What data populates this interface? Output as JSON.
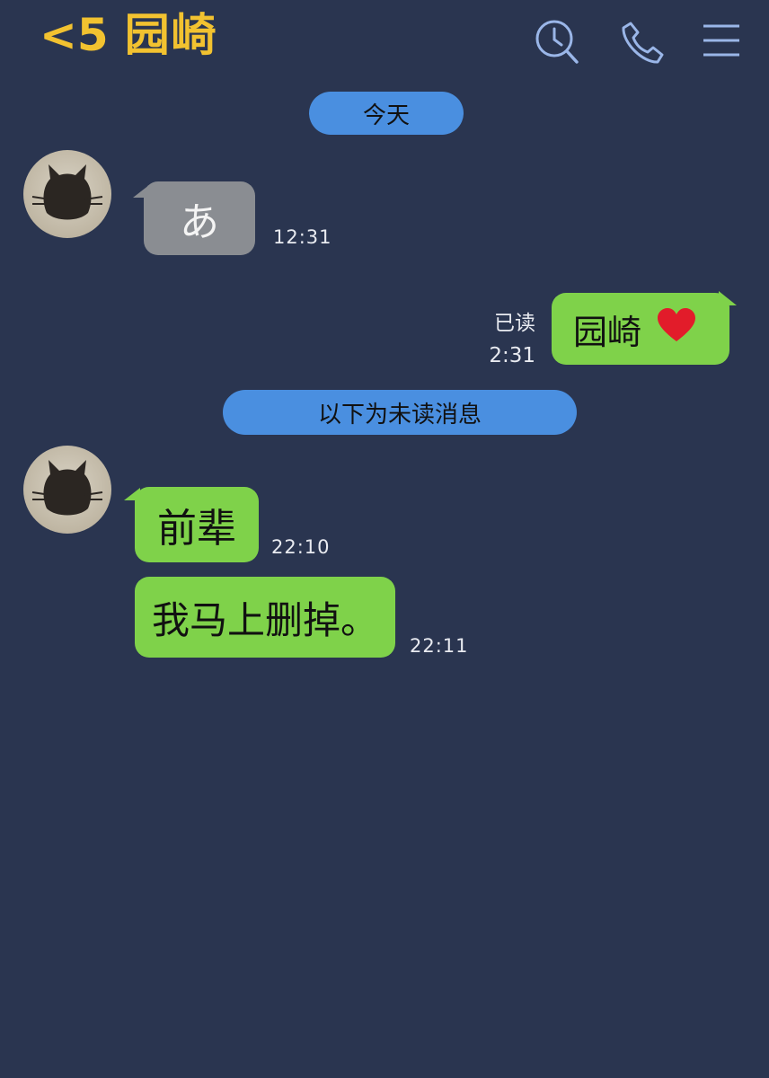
{
  "header": {
    "back_label": "<5",
    "title": "园崎",
    "accent_color": "#f2c230",
    "icons": [
      "search-clock-icon",
      "phone-icon",
      "menu-icon"
    ]
  },
  "dividers": {
    "today": "今天",
    "unread": "以下为未读消息"
  },
  "messages": [
    {
      "sender": "contact",
      "text": "あ",
      "time": "12:31",
      "bubble_color": "#8a8d92"
    },
    {
      "sender": "me",
      "text": "园崎",
      "emoji": "❤️",
      "read_label": "已读",
      "time": "2:31",
      "bubble_color": "#7fd24a"
    },
    {
      "sender": "contact",
      "text": "前辈",
      "time": "22:10",
      "bubble_color": "#7fd24a"
    },
    {
      "sender": "contact",
      "text": "我马上删掉。",
      "time": "22:11",
      "bubble_color": "#7fd24a"
    }
  ],
  "colors": {
    "background": "#2a3550",
    "pill": "#4a8fe0",
    "bubble_green": "#7fd24a",
    "bubble_gray": "#8a8d92"
  }
}
